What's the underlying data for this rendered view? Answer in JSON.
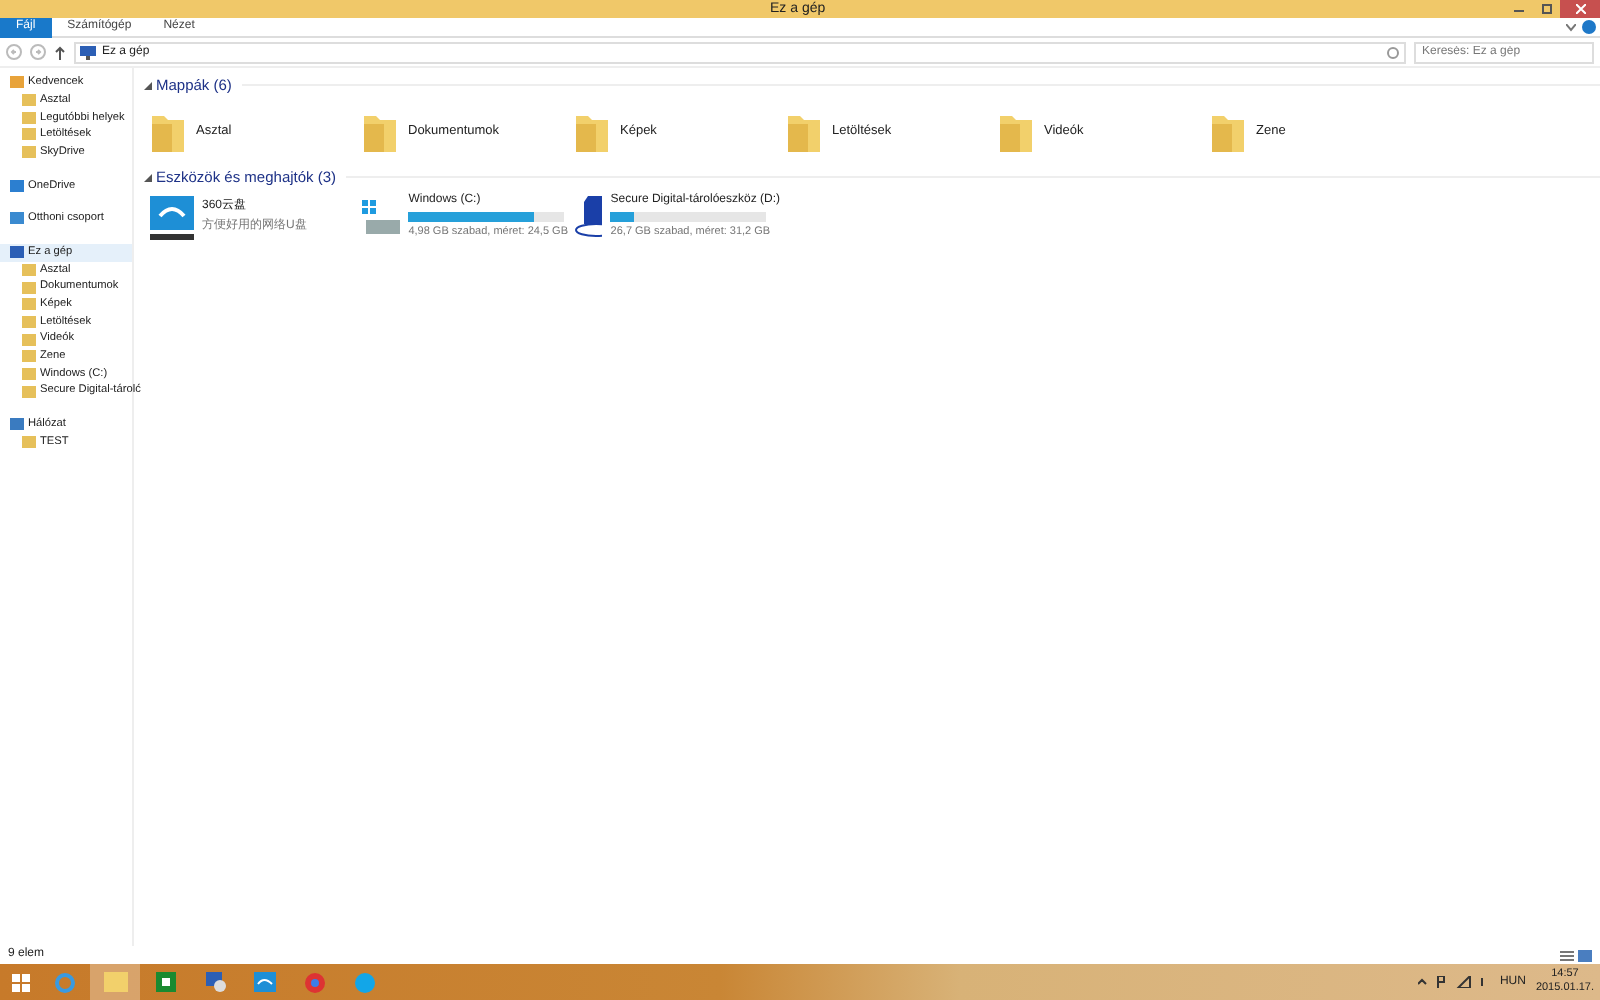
{
  "window": {
    "title": "Ez a gép"
  },
  "ribbon": {
    "tabs": [
      {
        "label": "Fájl",
        "selected": true
      },
      {
        "label": "Számítógép",
        "selected": false
      },
      {
        "label": "Nézet",
        "selected": false
      }
    ]
  },
  "address_bar": {
    "path": "Ez a gép",
    "search": {
      "placeholder": "Keresés: Ez a gép"
    }
  },
  "sidebar": {
    "items": [
      {
        "label": "Kedvencek",
        "selected": false,
        "children": [
          {
            "label": "Asztal",
            "selected": false
          },
          {
            "label": "Legutóbbi helyek",
            "selected": false
          },
          {
            "label": "Letöltések",
            "selected": false
          },
          {
            "label": "SkyDrive",
            "selected": false
          }
        ]
      },
      {
        "label": "OneDrive",
        "selected": false
      },
      {
        "label": "Otthoni csoport",
        "selected": false
      },
      {
        "label": "Ez a gép",
        "selected": true,
        "children": [
          {
            "label": "Asztal",
            "selected": false
          },
          {
            "label": "Dokumentumok",
            "selected": false
          },
          {
            "label": "Képek",
            "selected": false
          },
          {
            "label": "Letöltések",
            "selected": false
          },
          {
            "label": "Videók",
            "selected": false
          },
          {
            "label": "Zene",
            "selected": false
          },
          {
            "label": "Windows (C:)",
            "selected": false
          },
          {
            "label": "Secure Digital-tárolć",
            "selected": false
          }
        ]
      },
      {
        "label": "Hálózat",
        "selected": false,
        "children": [
          {
            "label": "TEST",
            "selected": false
          }
        ]
      }
    ]
  },
  "folders": {
    "heading": "Mappák (6)",
    "items": [
      {
        "label": "Asztal"
      },
      {
        "label": "Dokumentumok"
      },
      {
        "label": "Képek"
      },
      {
        "label": "Letöltések"
      },
      {
        "label": "Videók"
      },
      {
        "label": "Zene"
      }
    ]
  },
  "devices": {
    "heading": "Eszközök és meghajtók (3)",
    "items": [
      {
        "kind": "cloud",
        "name": "360云盘",
        "subtitle": "方便好用的网络U盘"
      },
      {
        "kind": "drive",
        "name": "Windows (C:)",
        "level": 0.8,
        "detail": "4,98 GB szabad, méret: 24,5 GB"
      },
      {
        "kind": "sd",
        "name": "Secure Digital-tárolóeszköz (D:)",
        "level": 0.15,
        "detail": "26,7 GB szabad, méret: 31,2 GB"
      }
    ]
  },
  "status_bar": {
    "count": "9 elem"
  },
  "taskbar": {
    "language": "HUN",
    "time": "14:57",
    "date": "2015.01.17."
  }
}
